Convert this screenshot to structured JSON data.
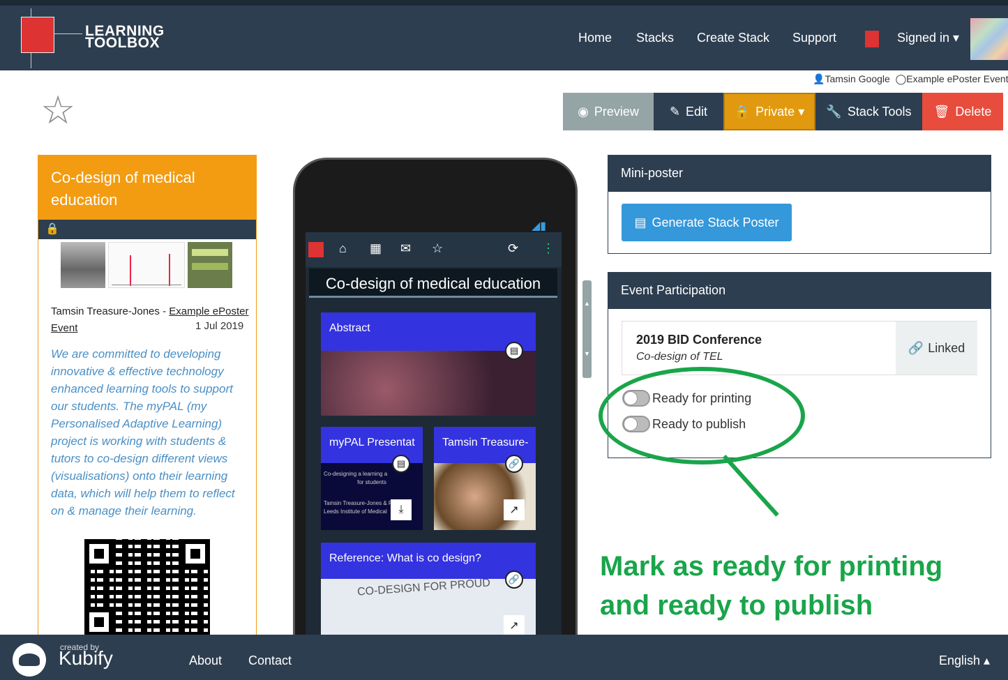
{
  "app": {
    "name_line1": "LEARNING",
    "name_line2": "TOOLBOX"
  },
  "nav": {
    "home": "Home",
    "stacks": "Stacks",
    "create": "Create Stack",
    "support": "Support",
    "signed_in": "Signed in ▾"
  },
  "owner": {
    "user": "Tamsin Google",
    "event": "Example ePoster Event"
  },
  "toolbar": {
    "preview": "Preview",
    "edit": "Edit",
    "private": "Private ▾",
    "tools": "Stack Tools",
    "delete": "Delete"
  },
  "card": {
    "title": "Co-design of medical education",
    "author": "Tamsin Treasure-Jones - ",
    "event_link": "Example ePoster Event",
    "date": "1 Jul 2019",
    "description": "We are committed to developing innovative & effective technology enhanced learning tools to support our students. The myPAL (my Personalised Adaptive Learning) project is working with students & tutors to co-design different views (visualisations) onto their learning data, which will help them to reflect on & manage their learning."
  },
  "phone": {
    "title": "Co-design of medical education",
    "tiles": {
      "abstract": "Abstract",
      "mypal": "myPAL Presentat",
      "tamsin": "Tamsin Treasure-",
      "reference": "Reference: What is co design?",
      "mypal_slide_line1": "Co-designing a learning a",
      "mypal_slide_line2": "for students",
      "mypal_slide_line3": "Tamsin Treasure-Jones & Ros",
      "mypal_slide_line4": "Leeds Institute of Medical",
      "cartoon_text": "CO-DESIGN FOR PROUD"
    }
  },
  "mini_poster": {
    "heading": "Mini-poster",
    "button": "Generate Stack Poster"
  },
  "event_participation": {
    "heading": "Event Participation",
    "event_name": "2019 BID Conference",
    "event_subtitle": "Co-design of TEL",
    "linked": "Linked",
    "ready_printing": "Ready for printing",
    "ready_publish": "Ready to publish"
  },
  "annotation": {
    "line1": "Mark as ready for printing",
    "line2": "and ready to publish"
  },
  "footer": {
    "created_by": "created by",
    "brand": "Kubify",
    "about": "About",
    "contact": "Contact",
    "language": "English ▴"
  },
  "colors": {
    "navy": "#2d3e50",
    "orange": "#f39c12",
    "green": "#19a54a",
    "blue": "#3498db",
    "red": "#e74c3c",
    "tile_blue": "#3433e0"
  }
}
